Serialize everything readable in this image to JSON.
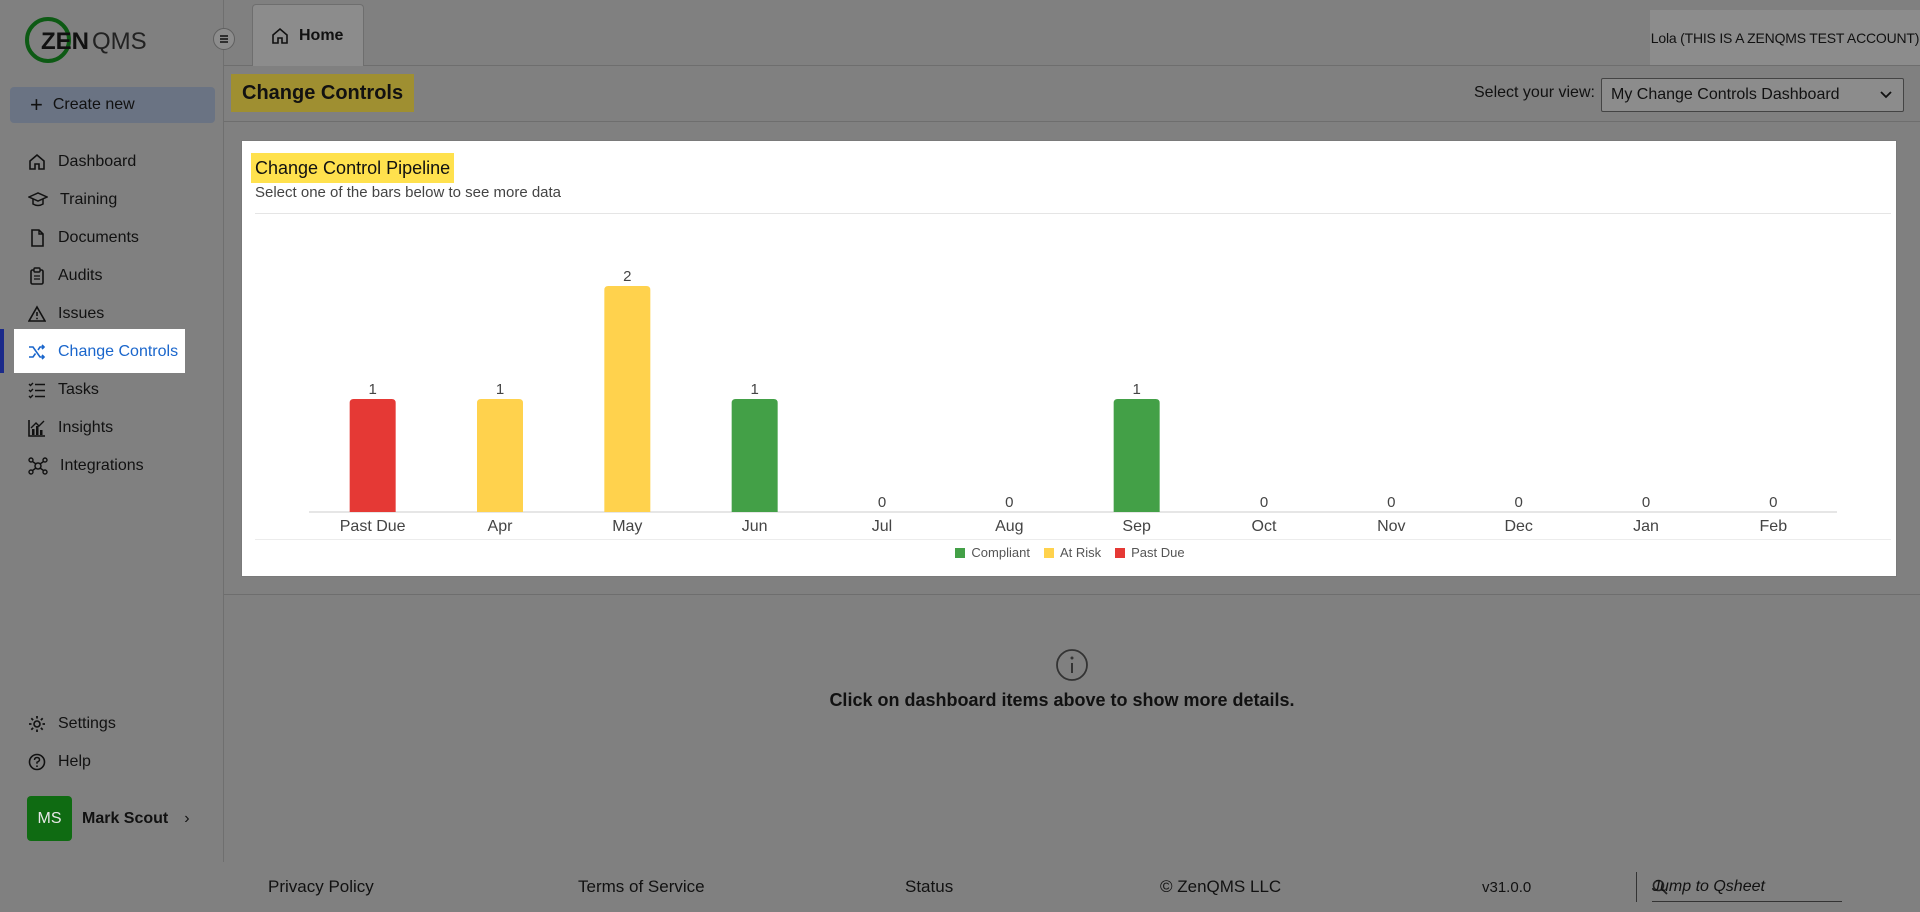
{
  "brand": {
    "logo_text": "ZENQMS"
  },
  "sidebar": {
    "create_label": "Create new",
    "items": [
      {
        "label": "Dashboard"
      },
      {
        "label": "Training"
      },
      {
        "label": "Documents"
      },
      {
        "label": "Audits"
      },
      {
        "label": "Issues"
      },
      {
        "label": "Change Controls"
      },
      {
        "label": "Tasks"
      },
      {
        "label": "Insights"
      },
      {
        "label": "Integrations"
      }
    ],
    "active_item": "Change Controls",
    "bottom_items": [
      {
        "label": "Settings"
      },
      {
        "label": "Help"
      }
    ],
    "user": {
      "initials": "MS",
      "name": "Mark Scout"
    }
  },
  "topbar": {
    "tab_home": "Home",
    "account": "Lola (THIS IS A ZENQMS TEST ACCOUNT)"
  },
  "page": {
    "title": "Change Controls",
    "view_label": "Select your view:",
    "view_value": "My Change Controls Dashboard"
  },
  "card": {
    "title": "Change Control Pipeline",
    "subtitle": "Select one of the bars below to see more data"
  },
  "chart_data": {
    "type": "bar",
    "categories": [
      "Past Due",
      "Apr",
      "May",
      "Jun",
      "Jul",
      "Aug",
      "Sep",
      "Oct",
      "Nov",
      "Dec",
      "Jan",
      "Feb"
    ],
    "values": [
      1,
      1,
      2,
      1,
      0,
      0,
      1,
      0,
      0,
      0,
      0,
      0
    ],
    "status": [
      "Past Due",
      "At Risk",
      "At Risk",
      "Compliant",
      "Compliant",
      "Compliant",
      "Compliant",
      "Compliant",
      "Compliant",
      "Compliant",
      "Compliant",
      "Compliant"
    ],
    "legend": [
      {
        "name": "Compliant",
        "color": "#43a047"
      },
      {
        "name": "At Risk",
        "color": "#ffd24d"
      },
      {
        "name": "Past Due",
        "color": "#e53935"
      }
    ],
    "ylim": [
      0,
      2
    ],
    "grid": false,
    "legend_position": "bottom"
  },
  "info": {
    "text": "Click on dashboard items above to show more details."
  },
  "footer": {
    "privacy": "Privacy Policy",
    "terms": "Terms of Service",
    "status": "Status",
    "copyright": "© ZenQMS LLC",
    "version": "v31.0.0",
    "search_placeholder": "Jump to Qsheet"
  }
}
